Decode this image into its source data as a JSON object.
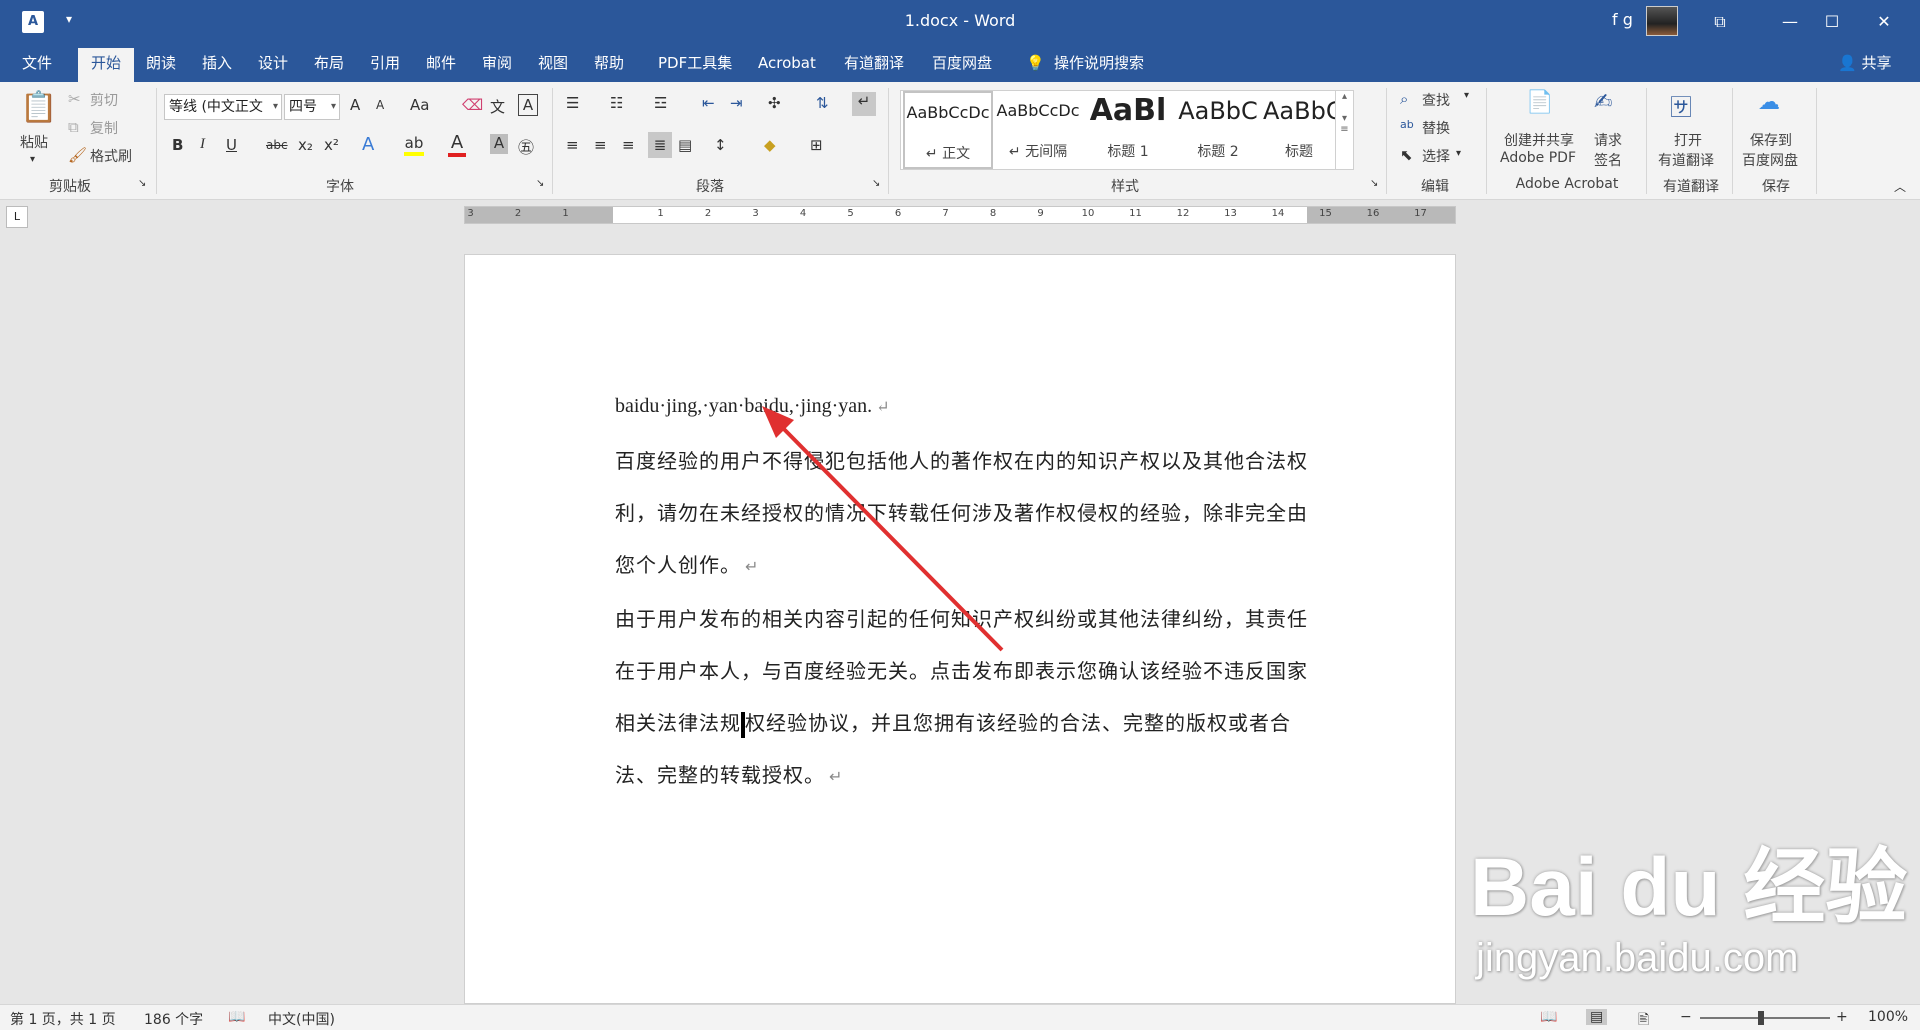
{
  "window": {
    "title": "1.docx  -  Word",
    "app_icon": "A",
    "quick_access": "▾",
    "user": "f g",
    "controls": [
      "⧉",
      "—",
      "☐",
      "✕"
    ]
  },
  "tabs": [
    "文件",
    "开始",
    "朗读",
    "插入",
    "设计",
    "布局",
    "引用",
    "邮件",
    "审阅",
    "视图",
    "帮助",
    "PDF工具集",
    "Acrobat",
    "有道翻译",
    "百度网盘"
  ],
  "tell_me": "操作说明搜索",
  "share": "共享",
  "clipboard": {
    "paste": "粘贴",
    "cut": "剪切",
    "copy": "复制",
    "format_painter": "格式刷",
    "label": "剪贴板"
  },
  "font": {
    "family": "等线 (中文正文",
    "size": "四号",
    "label": "字体",
    "grow": "A",
    "shrink": "A",
    "case": "Aa",
    "bold": "B",
    "italic": "I",
    "underline": "U",
    "strike": "abc",
    "subscript": "x₂",
    "superscript": "x²",
    "text_effects": "A",
    "font_color": "A",
    "char_shading": "A",
    "enclose": "㊄",
    "phonetic": "文"
  },
  "paragraph": {
    "label": "段落"
  },
  "styles": {
    "label": "样式",
    "items": [
      {
        "sample": "AaBbCcDc",
        "name": "↵ 正文"
      },
      {
        "sample": "AaBbCcDc",
        "name": "↵ 无间隔"
      },
      {
        "sample": "AaBl",
        "name": "标题 1"
      },
      {
        "sample": "AaBbC",
        "name": "标题 2"
      },
      {
        "sample": "AaBbC",
        "name": "标题"
      }
    ]
  },
  "editing": {
    "label": "编辑",
    "find": "查找",
    "replace": "替换",
    "select": "选择"
  },
  "acrobat": {
    "label": "Adobe Acrobat",
    "create_share_1": "创建并共享",
    "create_share_2": "Adobe PDF",
    "request_1": "请求",
    "request_2": "签名"
  },
  "youdao": {
    "label": "有道翻译",
    "open_1": "打开",
    "open_2": "有道翻译"
  },
  "baidu": {
    "label": "保存",
    "save_1": "保存到",
    "save_2": "百度网盘"
  },
  "ruler": {
    "corner": "L",
    "left_numbers": [
      "3",
      "2",
      "1"
    ],
    "numbers": [
      "1",
      "2",
      "3",
      "4",
      "5",
      "6",
      "7",
      "8",
      "9",
      "10",
      "11",
      "12",
      "13",
      "14",
      "15",
      "16",
      "17"
    ]
  },
  "document": {
    "line1": "baidu·jing,·yan·baidu,·jing·yan.",
    "para2": "百度经验的用户不得侵犯包括他人的著作权在内的知识产权以及其他合法权利，请勿在未经授权的情况下转载任何涉及著作权侵权的经验，除非完全由您个人创作。",
    "para3_a": "由于用户发布的相关内容引起的任何知识产权纠纷或其他法律纠纷，其责任在于用户本人，与百度经验无关。点击发布即表示您确认该经验不违反国家相关法律法规",
    "para3_b": "权经验协议，并且您拥有该经验的合法、完整的版权或者合法、完整的转载授权。",
    "paragraph_mark": "↵"
  },
  "watermark": {
    "logo": "Bai du 经验",
    "url": "jingyan.baidu.com"
  },
  "status": {
    "page": "第 1 页，共 1 页",
    "words": "186 个字",
    "language": "中文(中国)",
    "zoom": "100%",
    "zoom_minus": "−",
    "zoom_plus": "+"
  },
  "colors": {
    "brand": "#2b579a",
    "arrow": "#e03030",
    "highlight": "#ffff00",
    "font_color_bar": "#e02020"
  }
}
